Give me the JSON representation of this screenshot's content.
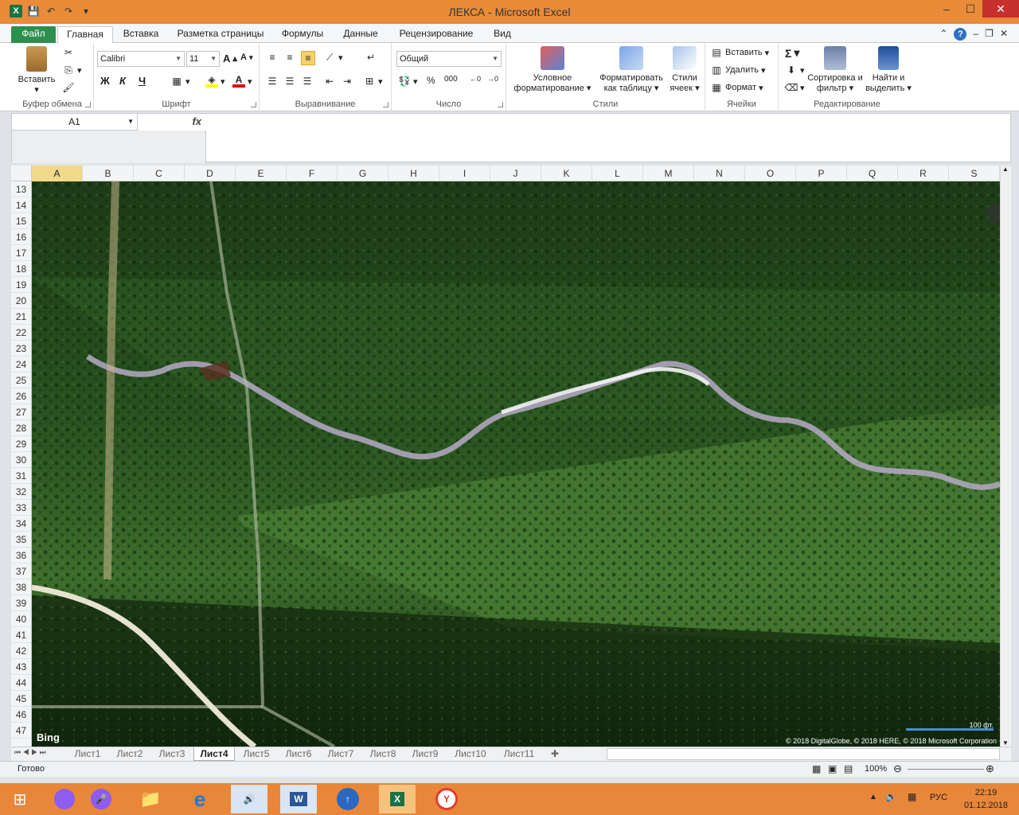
{
  "window": {
    "title": "ЛЕКСА - Microsoft Excel"
  },
  "tabs": {
    "file": "Файл",
    "items": [
      "Главная",
      "Вставка",
      "Разметка страницы",
      "Формулы",
      "Данные",
      "Рецензирование",
      "Вид"
    ],
    "active": "Главная"
  },
  "ribbon": {
    "clipboard": {
      "label": "Буфер обмена",
      "paste": "Вставить"
    },
    "font": {
      "label": "Шрифт",
      "name": "Calibri",
      "size": "11",
      "bold": "Ж",
      "italic": "К",
      "underline": "Ч"
    },
    "alignment": {
      "label": "Выравнивание"
    },
    "number": {
      "label": "Число",
      "format": "Общий",
      "percent": "%",
      "thousands": "000"
    },
    "styles": {
      "label": "Стили",
      "conditional": "Условное форматирование",
      "as_table": "Форматировать как таблицу",
      "cell_styles": "Стили ячеек"
    },
    "cells": {
      "label": "Ячейки",
      "insert": "Вставить",
      "delete": "Удалить",
      "format": "Формат"
    },
    "editing": {
      "label": "Редактирование",
      "sort": "Сортировка и фильтр",
      "find": "Найти и выделить"
    }
  },
  "formula_bar": {
    "name_box": "A1",
    "fx": "fx",
    "value": ""
  },
  "columns": [
    "A",
    "B",
    "C",
    "D",
    "E",
    "F",
    "G",
    "H",
    "I",
    "J",
    "K",
    "L",
    "M",
    "N",
    "O",
    "P",
    "Q",
    "R",
    "S"
  ],
  "selected_column": "A",
  "rows": [
    "13",
    "14",
    "15",
    "16",
    "17",
    "18",
    "19",
    "20",
    "21",
    "22",
    "23",
    "24",
    "25",
    "26",
    "27",
    "28",
    "29",
    "30",
    "31",
    "32",
    "33",
    "34",
    "35",
    "36",
    "37",
    "38",
    "39",
    "40",
    "41",
    "42",
    "43",
    "44",
    "45",
    "46",
    "47"
  ],
  "map": {
    "provider": "Bing",
    "scale": "100 фт.",
    "copyright": "© 2018 DigitalGlobe, © 2018 HERE, © 2018 Microsoft Corporation"
  },
  "sheets": [
    "Лист1",
    "Лист2",
    "Лист3",
    "Лист4",
    "Лист5",
    "Лист6",
    "Лист7",
    "Лист8",
    "Лист9",
    "Лист10",
    "Лист11"
  ],
  "active_sheet": "Лист4",
  "status": {
    "ready": "Готово",
    "zoom": "100%"
  },
  "taskbar": {
    "lang": "РУС",
    "time": "22:19",
    "date": "01.12.2018"
  }
}
